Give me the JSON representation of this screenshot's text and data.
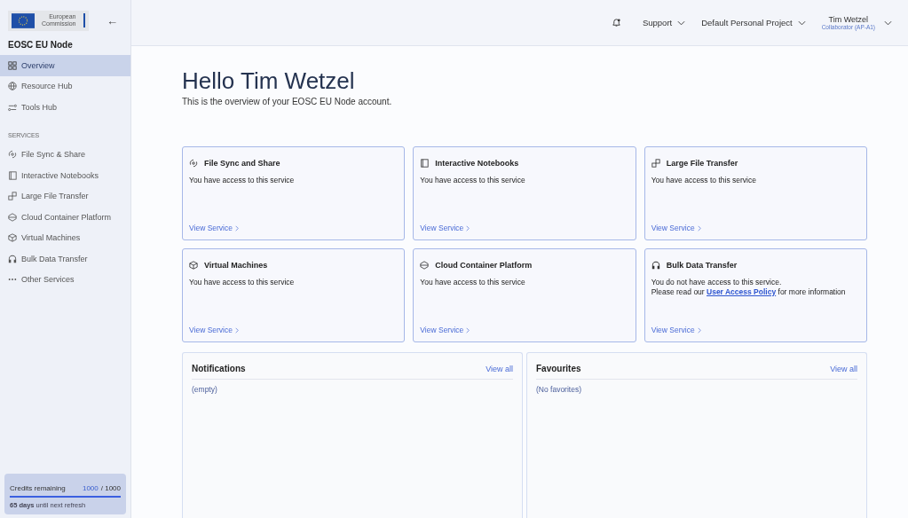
{
  "sidebar": {
    "logo_text": [
      "European",
      "Commission"
    ],
    "back": "←",
    "title": "EOSC EU Node",
    "items": [
      {
        "label": "Overview",
        "selected": true
      },
      {
        "label": "Resource Hub",
        "selected": false
      },
      {
        "label": "Tools Hub",
        "selected": false
      }
    ],
    "section": "SERVICES",
    "services": [
      {
        "label": "File Sync & Share",
        "selected": false
      },
      {
        "label": "Interactive Notebooks",
        "selected": false
      },
      {
        "label": "Large File Transfer",
        "selected": false
      },
      {
        "label": "Cloud Container Platform",
        "selected": false
      },
      {
        "label": "Virtual Machines",
        "selected": false
      },
      {
        "label": "Bulk Data Transfer",
        "selected": false
      },
      {
        "label": "Other Services",
        "selected": false
      }
    ],
    "credits": {
      "label": "Credits remaining",
      "value": "1000",
      "total": "/ 1000",
      "level": 1,
      "refresh": "**65 days** until next refresh"
    }
  },
  "topbar": {
    "support": "Support",
    "project": "Default Personal Project",
    "user": "Tim Wetzel",
    "role": "Collaborator (AP-A1)"
  },
  "greeting": "Hello Tim Wetzel",
  "subtitle": "This is the overview of your EOSC EU Node account.",
  "cards": [
    {
      "title": "File Sync and Share",
      "lines": [
        "You have access to this service"
      ],
      "link": "View Service"
    },
    {
      "title": "Interactive Notebooks",
      "lines": [
        "You have access to this service"
      ],
      "link": "View Service"
    },
    {
      "title": "Large File Transfer",
      "lines": [
        "You have access to this service"
      ],
      "link": "View Service"
    },
    {
      "title": "Virtual Machines",
      "lines": [
        "You have access to this service"
      ],
      "link": "View Service"
    },
    {
      "title": "Cloud Container Platform",
      "lines": [
        "You have access to this service"
      ],
      "link": "View Service"
    },
    {
      "title": "Bulk Data Transfer",
      "lines": [
        "You do not have access to this service."
      ],
      "notice": {
        "before": "Please read our",
        "link": "User Access Policy",
        "after": "for more information"
      },
      "link": "View Service"
    }
  ],
  "panels": [
    {
      "title": "Notifications",
      "action": "View all",
      "empty": "(empty)"
    },
    {
      "title": "Favourites",
      "action": "View all",
      "empty": "(No favorites)"
    }
  ]
}
